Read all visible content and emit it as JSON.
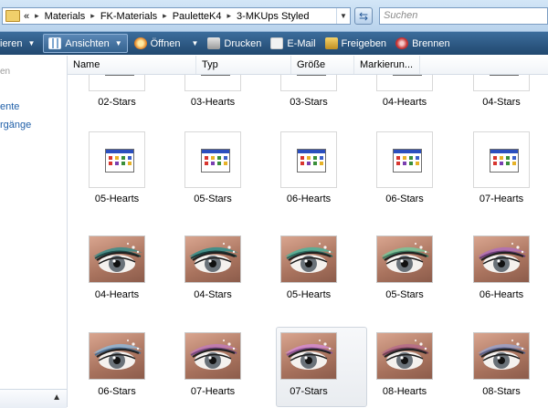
{
  "address": {
    "overflow": "«",
    "path": [
      "Materials",
      "FK-Materials",
      "PauletteK4",
      "3-MKUps Styled"
    ],
    "separator": "▸"
  },
  "search": {
    "placeholder": "Suchen"
  },
  "toolbar": {
    "organize": "ieren",
    "views": "Ansichten",
    "open": "Öffnen",
    "print": "Drucken",
    "email": "E-Mail",
    "share": "Freigeben",
    "burn": "Brennen"
  },
  "nav": {
    "faint_top": "en",
    "links": [
      "ente",
      "rgänge"
    ]
  },
  "columns": [
    "Name",
    "Typ",
    "Größe",
    "Markierun..."
  ],
  "rows": [
    {
      "kind": "doc",
      "labels": [
        "02-Stars",
        "03-Hearts",
        "03-Stars",
        "04-Hearts",
        "04-Stars"
      ]
    },
    {
      "kind": "doc",
      "labels": [
        "05-Hearts",
        "05-Stars",
        "06-Hearts",
        "06-Stars",
        "07-Hearts"
      ]
    },
    {
      "kind": "eye",
      "labels": [
        "04-Hearts",
        "04-Stars",
        "05-Hearts",
        "05-Stars",
        "06-Hearts"
      ]
    },
    {
      "kind": "eye",
      "labels": [
        "06-Stars",
        "07-Hearts",
        "07-Stars",
        "08-Hearts",
        "08-Stars"
      ]
    }
  ],
  "selected_item": "07-Stars",
  "colors": {
    "toolbar": "#2c5680",
    "link": "#1f5fa8",
    "eye_shadows": [
      [
        "#3a8d8a",
        "#1d4e4c"
      ],
      [
        "#2f8f8c",
        "#163f3e"
      ],
      [
        "#4cb39a",
        "#2a6c61"
      ],
      [
        "#78c59a",
        "#3d7f62"
      ],
      [
        "#b06fb8",
        "#6b3d78"
      ],
      [
        "#8fb6d6",
        "#4d6f92"
      ],
      [
        "#c07ab7",
        "#7a4a83"
      ],
      [
        "#d28bd0",
        "#8d5494"
      ],
      [
        "#b56b8a",
        "#744058"
      ],
      [
        "#9aa1c8",
        "#5b6188"
      ]
    ]
  }
}
